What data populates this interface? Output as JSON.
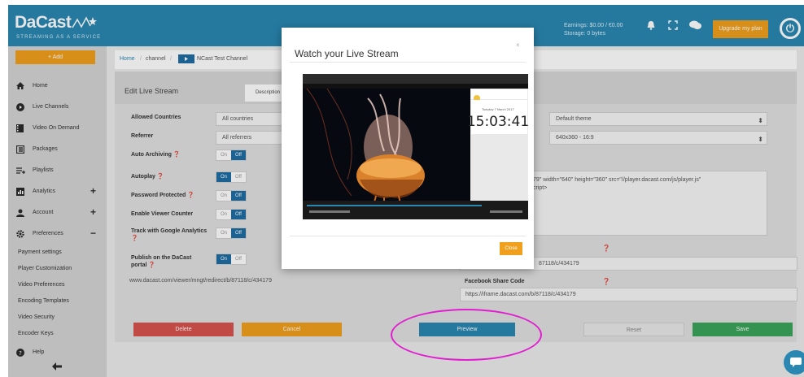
{
  "app": {
    "logo_text": "DaCast",
    "logo_tagline": "STREAMING AS A SERVICE"
  },
  "topbar": {
    "earnings": "Earnings: $0.00 / €0.00",
    "storage": "Storage: 0 bytes",
    "upgrade_label": "Upgrade my plan",
    "icons": [
      "bell-icon",
      "fullscreen-icon",
      "chat-icon",
      "power-icon"
    ]
  },
  "sidebar": {
    "add_label": "+ Add",
    "items": [
      {
        "label": "Home",
        "icon": "home-icon"
      },
      {
        "label": "Live Channels",
        "icon": "live-icon"
      },
      {
        "label": "Video On Demand",
        "icon": "film-icon"
      },
      {
        "label": "Packages",
        "icon": "packages-icon"
      },
      {
        "label": "Playlists",
        "icon": "playlist-icon"
      },
      {
        "label": "Analytics",
        "icon": "analytics-icon",
        "expander": "+"
      },
      {
        "label": "Account",
        "icon": "account-icon",
        "expander": "+"
      },
      {
        "label": "Preferences",
        "icon": "gear-icon",
        "expander": "−"
      }
    ],
    "sub_items": [
      "Payment settings",
      "Player Customization",
      "Video Preferences",
      "Encoding Templates",
      "Video Security",
      "Encoder Keys"
    ],
    "help_label": "Help",
    "back_icon": "arrow-left-icon"
  },
  "breadcrumb": {
    "home": "Home",
    "sep": "/",
    "channel": "channel",
    "current": "NCast Test Channel"
  },
  "edit": {
    "title": "Edit Live Stream",
    "desc_tab": "Description"
  },
  "fields": {
    "allowed_countries": {
      "label": "Allowed Countries",
      "value": "All countries"
    },
    "referrer": {
      "label": "Referrer",
      "value": "All referrers"
    },
    "auto_archiving": {
      "label": "Auto Archiving ❓",
      "state": "off"
    },
    "autoplay": {
      "label": "Autoplay ❓",
      "state": "on"
    },
    "password_protected": {
      "label": "Password Protected ❓",
      "state": "off"
    },
    "viewer_counter": {
      "label": "Enable Viewer Counter",
      "state": "off"
    },
    "google_analytics": {
      "label": "Track with Google Analytics ❓",
      "state": "off"
    },
    "publish_portal": {
      "label": "Publish on the DaCast portal ❓",
      "state": "on"
    }
  },
  "toggle_text": {
    "on": "On",
    "off": "Off"
  },
  "right_col": {
    "theme": "Default theme",
    "size": "640x360 - 16:9",
    "embed_line1": "79\" width=\"640\" height=\"360\" src=\"//player.dacast.com/js/player.js\"",
    "embed_line2": "cript>",
    "share_url_tail": "87118/c/434179",
    "fb_label": "Facebook Share Code",
    "fb_url": "https://iframe.dacast.com/b/87118/c/434179"
  },
  "portal_url": "www.dacast.com/viewer/mngt/redirect/b/87118/c/434179",
  "buttons": {
    "delete": "Delete",
    "cancel": "Cancel",
    "preview": "Preview",
    "reset": "Reset",
    "save": "Save"
  },
  "colors": {
    "brand_blue": "#2a87b1",
    "accent_orange": "#f0a01c",
    "delete_red": "#d9534f",
    "save_green": "#3aa45a",
    "preview_blue": "#2a87b1",
    "highlight_magenta": "#e21cd1"
  },
  "modal": {
    "title": "Watch your Live Stream",
    "close_x": "×",
    "close_label": "Close",
    "clock_date": "Tuesday 7 March 2017",
    "clock_time": "15:03:41"
  }
}
